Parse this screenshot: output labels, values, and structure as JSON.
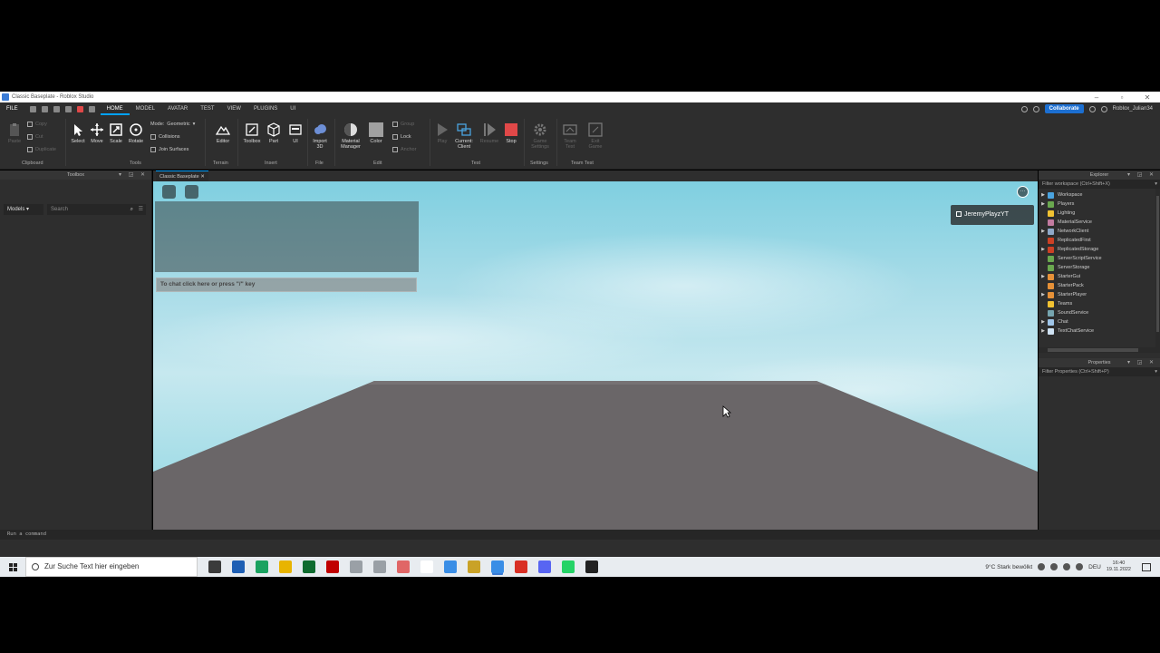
{
  "window": {
    "title": "Classic Baseplate - Roblox Studio"
  },
  "menu": {
    "items": [
      "FILE",
      "HOME",
      "MODEL",
      "AVATAR",
      "TEST",
      "VIEW",
      "PLUGINS",
      "UI"
    ],
    "active": "HOME",
    "collaborate": "Collaborate",
    "username": "Roblox_Julian34"
  },
  "ribbon": {
    "clipboard": {
      "paste": "Paste",
      "copy": "Copy",
      "cut": "Cut",
      "duplicate": "Duplicate",
      "label": "Clipboard"
    },
    "tools": {
      "select": "Select",
      "move": "Move",
      "scale": "Scale",
      "rotate": "Rotate",
      "mode_label": "Mode:",
      "mode_value": "Geometric",
      "collisions": "Collisions",
      "join_surfaces": "Join Surfaces",
      "label": "Tools"
    },
    "terrain": {
      "editor": "Editor",
      "label": "Terrain"
    },
    "insert": {
      "toolbox": "Toolbox",
      "part": "Part",
      "ui": "UI",
      "label": "Insert"
    },
    "file": {
      "import3d": "Import 3D",
      "label": "File"
    },
    "edit": {
      "material": "Material Manager",
      "color": "Color",
      "group": "Group",
      "lock": "Lock",
      "anchor": "Anchor",
      "label": "Edit"
    },
    "test": {
      "play": "Play",
      "client": "Current: Client",
      "resume": "Resume",
      "stop": "Stop",
      "label": "Test"
    },
    "settings": {
      "game_settings": "Game Settings",
      "label": "Settings"
    },
    "team_test": {
      "team_test": "Team Test",
      "exit_game": "Exit Game",
      "label": "Team Test"
    }
  },
  "toolbox": {
    "title": "Toolbox",
    "category": "Models",
    "search_placeholder": "Search"
  },
  "document": {
    "tab": "Classic Baseplate"
  },
  "viewport": {
    "chat_placeholder": "To chat click here or press \"/\" key",
    "player_name": "JeremyPlayzYT"
  },
  "explorer": {
    "title": "Explorer",
    "filter": "Filter workspace (Ctrl+Shift+X)",
    "items": [
      {
        "label": "Workspace",
        "expand": "▶",
        "color": "#4aa3df"
      },
      {
        "label": "Players",
        "expand": "▶",
        "color": "#6aa84f"
      },
      {
        "label": "Lighting",
        "expand": "",
        "color": "#f1c232"
      },
      {
        "label": "MaterialService",
        "expand": "",
        "color": "#c27ba0"
      },
      {
        "label": "NetworkClient",
        "expand": "▶",
        "color": "#8fa8c8"
      },
      {
        "label": "ReplicatedFirst",
        "expand": "",
        "color": "#cc4125"
      },
      {
        "label": "ReplicatedStorage",
        "expand": "▶",
        "color": "#cc4125"
      },
      {
        "label": "ServerScriptService",
        "expand": "",
        "color": "#6aa84f"
      },
      {
        "label": "ServerStorage",
        "expand": "",
        "color": "#6aa84f"
      },
      {
        "label": "StarterGui",
        "expand": "▶",
        "color": "#e69138"
      },
      {
        "label": "StarterPack",
        "expand": "",
        "color": "#e69138"
      },
      {
        "label": "StarterPlayer",
        "expand": "▶",
        "color": "#e69138"
      },
      {
        "label": "Teams",
        "expand": "",
        "color": "#f1c232"
      },
      {
        "label": "SoundService",
        "expand": "",
        "color": "#76a5af"
      },
      {
        "label": "Chat",
        "expand": "▶",
        "color": "#9fc5e8"
      },
      {
        "label": "TextChatService",
        "expand": "▶",
        "color": "#cfe2f3"
      }
    ]
  },
  "properties": {
    "title": "Properties",
    "filter": "Filter Properties (Ctrl+Shift+P)"
  },
  "command_bar": {
    "placeholder": "Run a command"
  },
  "taskbar": {
    "search_placeholder": "Zur Suche Text hier eingeben",
    "weather": "9°C  Stark bewölkt",
    "lang": "DEU",
    "time": "16:40",
    "date": "19.11.2022",
    "app_colors": [
      "#3b3b3b",
      "#1e5fb4",
      "#1aa260",
      "#e8b400",
      "#0f6b2f",
      "#c00000",
      "#9aa0a6",
      "#9aa0a6",
      "#e06666",
      "#ffffff",
      "#3a8ee6",
      "#c9a227",
      "#3a8ee6",
      "#d93025",
      "#5865f2",
      "#25d366",
      "#222222"
    ]
  }
}
